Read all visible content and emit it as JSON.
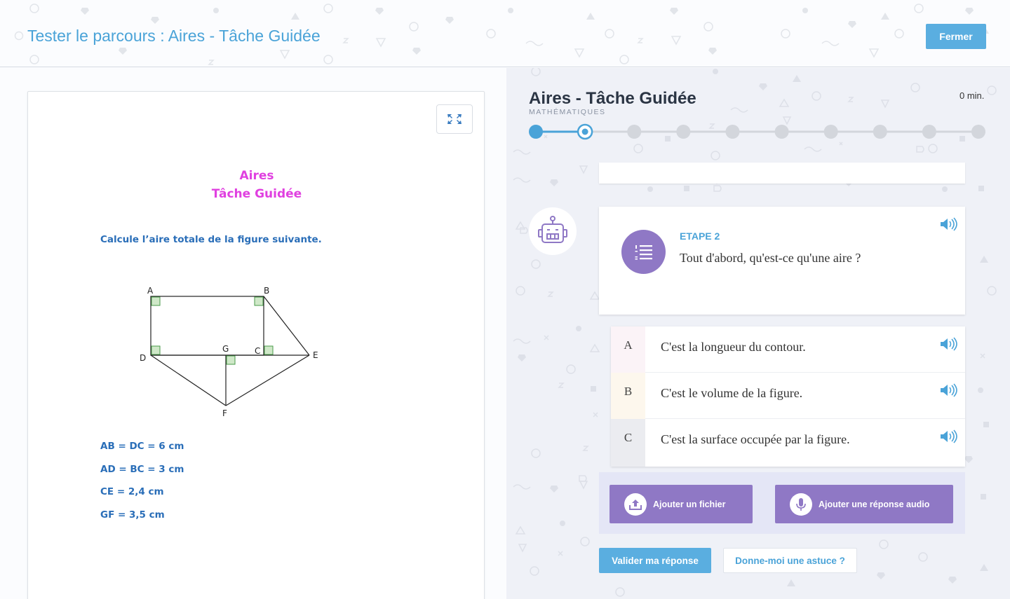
{
  "header": {
    "title": "Tester le parcours : Aires - Tâche Guidée",
    "close_label": "Fermer"
  },
  "document": {
    "title_line1": "Aires",
    "title_line2": "Tâche Guidée",
    "instruction": "Calcule l’aire totale de la figure suivante.",
    "figure_labels": {
      "a": "A",
      "b": "B",
      "c": "C",
      "d": "D",
      "e": "E",
      "f": "F",
      "g": "G"
    },
    "measures": [
      "AB = DC = 6 cm",
      "AD = BC = 3 cm",
      "CE = 2,4 cm",
      "GF = 3,5 cm"
    ]
  },
  "task": {
    "title": "Aires - Tâche Guidée",
    "subject": "MATHÉMATIQUES",
    "timer": "0 min.",
    "progress": {
      "total_steps": 10,
      "completed_steps": 1,
      "current_step": 2
    }
  },
  "question": {
    "step_label": "ETAPE 2",
    "text": "Tout d'abord, qu'est-ce qu'une aire ?"
  },
  "answers": [
    {
      "letter": "A",
      "text": "C'est la longueur du contour.",
      "color": "#fbf3f7"
    },
    {
      "letter": "B",
      "text": "C'est le volume de la figure.",
      "color": "#fdf7ed"
    },
    {
      "letter": "C",
      "text": "C'est la surface occupée par la figure.",
      "color": "#ebecf0"
    }
  ],
  "actions": {
    "add_file": "Ajouter un fichier",
    "add_audio": "Ajouter une réponse audio",
    "validate": "Valider ma réponse",
    "hint": "Donne-moi une astuce ?"
  },
  "colors": {
    "accent_blue": "#5aaee0",
    "purple": "#8f78c5",
    "doc_title_pink": "#e040e0",
    "doc_text_blue": "#2a6eb8"
  },
  "icons": [
    "expand-icon",
    "robot-icon",
    "numbered-list-icon",
    "speaker-icon",
    "upload-icon",
    "microphone-icon"
  ]
}
